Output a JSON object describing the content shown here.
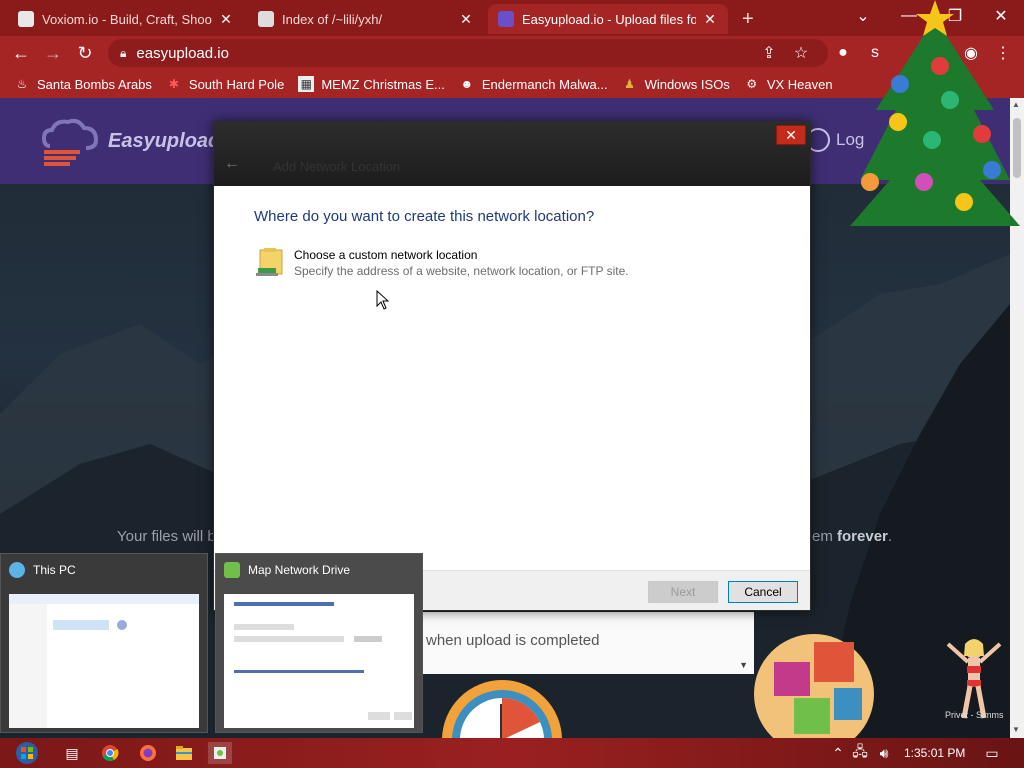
{
  "browser": {
    "tabs": [
      {
        "title": "Voxiom.io - Build, Craft, Shoot",
        "active": false
      },
      {
        "title": "Index of /~lili/yxh/",
        "active": false
      },
      {
        "title": "Easyupload.io - Upload files for f",
        "active": true
      }
    ],
    "new_tab_label": "+",
    "url": "easyupload.io",
    "bookmarks": [
      "Santa Bombs Arabs",
      "South Hard Pole",
      "MEMZ Christmas E...",
      "Endermanch Malwa...",
      "Windows ISOs",
      "VX Heaven"
    ]
  },
  "site": {
    "name": "Easyupload.i",
    "login_label": "Log",
    "files_text_left": "Your files will b",
    "files_text_right_prefix": "em ",
    "files_text_right_bold": "forever",
    "files_text_right_suffix": ".",
    "upload_option_text": "when upload is completed"
  },
  "dialog": {
    "title": "Add Network Location",
    "heading": "Where do you want to create this network location?",
    "option_title": "Choose a custom network location",
    "option_desc": "Specify the address of a website, network location, or FTP site.",
    "next_label": "Next",
    "cancel_label": "Cancel",
    "close_glyph": "✕"
  },
  "previews": [
    {
      "title": "This PC"
    },
    {
      "title": "Map Network Drive"
    }
  ],
  "tray": {
    "time": "1:35:01 PM"
  },
  "overlay": {
    "girl_label": "Privet - Simms"
  },
  "colors": {
    "chrome_frame": "#8b1a1a",
    "site_header": "#3f2e74",
    "dialog_heading": "#1e3a78"
  }
}
